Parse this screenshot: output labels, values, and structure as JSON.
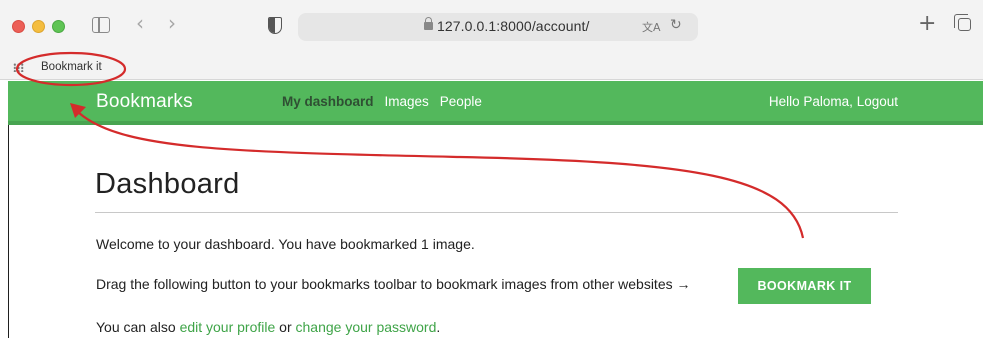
{
  "browser": {
    "url": "127.0.0.1:8000/account/",
    "nav_back_glyph": "‹",
    "nav_forward_glyph": "›",
    "translate_glyph": "文A",
    "reload_glyph": "↻",
    "new_tab_glyph": "+",
    "bookmarks_bar": {
      "items": [
        {
          "label": "Bookmark it"
        }
      ]
    }
  },
  "site": {
    "logo": "Bookmarks",
    "menu": [
      {
        "label": "My dashboard",
        "active": true
      },
      {
        "label": "Images",
        "active": false
      },
      {
        "label": "People",
        "active": false
      }
    ],
    "user": {
      "greeting": "Hello Paloma,",
      "logout": "Logout"
    },
    "accent_color": "#53b85c",
    "link_color": "#3fa448"
  },
  "page": {
    "title": "Dashboard",
    "welcome": "Welcome to your dashboard. You have bookmarked 1 image.",
    "drag_text": "Drag the following button to your bookmarks toolbar to bookmark images from other websites →",
    "bookmark_button": "BOOKMARK IT",
    "also_prefix": "You can also",
    "edit_profile_link": "edit your profile",
    "or_text": "or",
    "change_password_link": "change your password",
    "period": "."
  },
  "annotation": {
    "color": "#d42b2b",
    "icons": [
      "ellipse-highlight",
      "curved-arrow"
    ]
  }
}
